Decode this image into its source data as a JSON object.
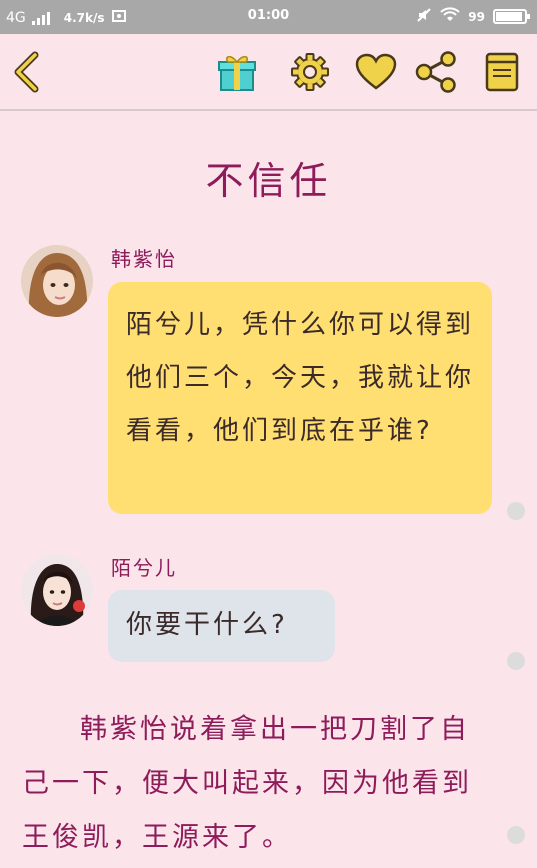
{
  "status_bar": {
    "network": "4G",
    "speed": "4.7k/s",
    "time": "01:00",
    "battery": "99",
    "battery_level": 0.99
  },
  "toolbar": {
    "icons": [
      "back-chevron-icon",
      "gift-icon",
      "gear-icon",
      "heart-icon",
      "share-icon",
      "book-icon"
    ],
    "accent": "#f0d24a",
    "outline": "#4a3a1a"
  },
  "chapter": {
    "title": "不信任"
  },
  "messages": [
    {
      "speaker": "韩紫怡",
      "text": "陌兮儿，凭什么你可以得到他们三个，今天，我就让你看看，他们到底在乎谁?",
      "bubble_color": "#ffde72"
    },
    {
      "speaker": "陌兮儿",
      "text": "你要干什么?",
      "bubble_color": "#dfe3ea"
    }
  ],
  "narration": "韩紫怡说着拿出一把刀割了自己一下，便大叫起来，因为他看到王俊凯，王源来了。"
}
